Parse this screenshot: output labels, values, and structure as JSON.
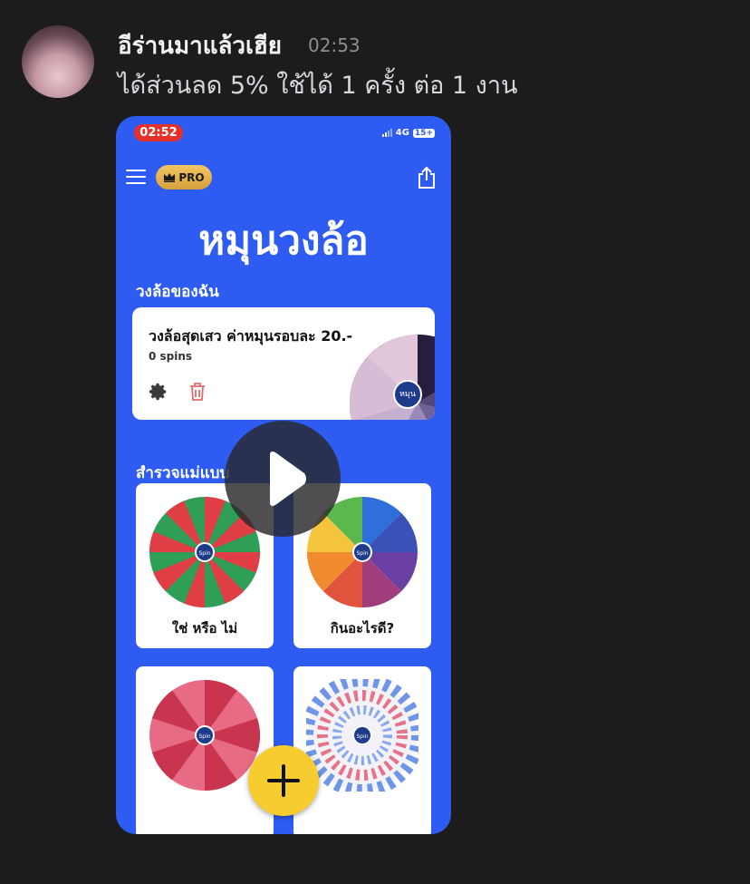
{
  "chat": {
    "sender": "อีร่านมาแล้วเฮีย",
    "time": "02:53",
    "message": "ได้ส่วนลด 5% ใช้ได้ 1 ครั้ง ต่อ 1 งาน"
  },
  "phone": {
    "status_time": "02:52",
    "network": "4G",
    "battery": "15+",
    "pro_label": "PRO",
    "title": "หมุนวงล้อ",
    "section_mine": "วงล้อของฉัน",
    "my_wheel": {
      "title": "วงล้อสุดเสว ค่าหมุนรอบละ 20.-",
      "spins": "0 spins",
      "hub_label": "หมุน"
    },
    "section_explore": "สำรวจแม่แบบ",
    "templates": [
      {
        "label": "ใช่ หรือ ไม่",
        "hub": "Spin"
      },
      {
        "label": "กินอะไรดี?",
        "hub": "Spin"
      },
      {
        "label": "",
        "hub": "Spin"
      },
      {
        "label": "",
        "hub": "Spin"
      }
    ]
  },
  "icons": {
    "menu": "hamburger-icon",
    "share": "share-icon",
    "settings": "gear-icon",
    "delete": "trash-icon",
    "add": "plus-icon",
    "play": "play-icon",
    "crown": "crown-icon"
  },
  "colors": {
    "background": "#1c1c1e",
    "app_blue": "#2e5cf2",
    "fab_yellow": "#f7cc2f",
    "status_red": "#e5312a"
  }
}
